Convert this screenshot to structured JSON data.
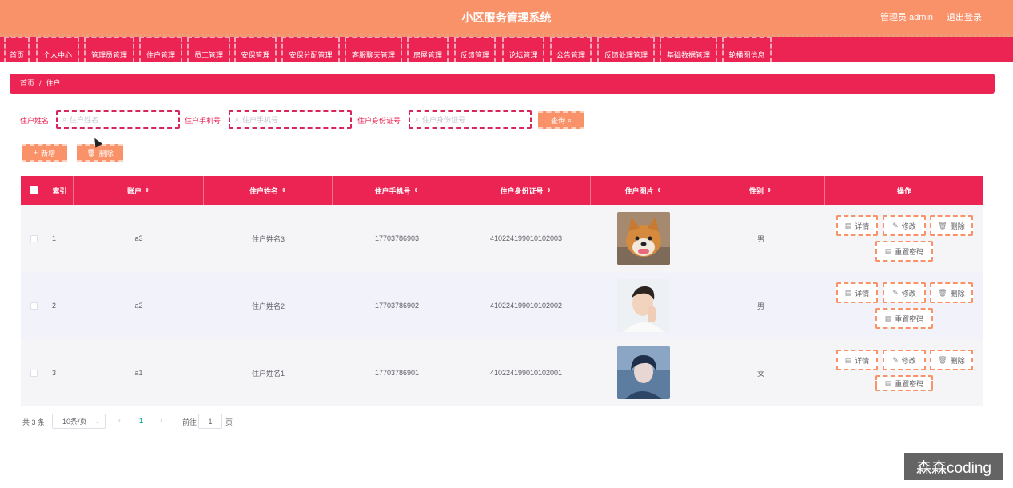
{
  "header": {
    "title": "小区服务管理系统",
    "admin": "管理员 admin",
    "logout": "退出登录"
  },
  "nav": [
    "首页",
    "个人中心",
    "管理员管理",
    "住户管理",
    "员工管理",
    "安保管理",
    "安保分配管理",
    "客服聊天管理",
    "房屋管理",
    "反馈管理",
    "论坛管理",
    "公告管理",
    "反馈处理管理",
    "基础数据管理",
    "轮播图信息"
  ],
  "breadcrumb": {
    "home": "首页",
    "sep": "/",
    "current": "住户"
  },
  "search": {
    "name_label": "住户姓名",
    "name_placeholder": "住户姓名",
    "phone_label": "住户手机号",
    "phone_placeholder": "住户手机号",
    "id_label": "住户身份证号",
    "id_placeholder": "住户身份证号",
    "query": "查询"
  },
  "actions": {
    "add": "新增",
    "delete": "删除"
  },
  "table": {
    "headers": [
      "索引",
      "账户",
      "住户姓名",
      "住户手机号",
      "住户身份证号",
      "住户图片",
      "性别",
      "操作"
    ],
    "rows": [
      {
        "index": "1",
        "account": "a3",
        "name": "住户姓名3",
        "phone": "17703786903",
        "idcard": "410224199010102003",
        "gender": "男",
        "photo": "shiba-dog"
      },
      {
        "index": "2",
        "account": "a2",
        "name": "住户姓名2",
        "phone": "17703786902",
        "idcard": "410224199010102002",
        "gender": "男",
        "photo": "young-man"
      },
      {
        "index": "3",
        "account": "a1",
        "name": "住户姓名1",
        "phone": "17703786901",
        "idcard": "410224199010102001",
        "gender": "女",
        "photo": "anime-boy"
      }
    ],
    "ops": {
      "detail": "详情",
      "edit": "修改",
      "delete": "删除",
      "reset": "重置密码"
    }
  },
  "pagination": {
    "total": "共 3 条",
    "size": "10条/页",
    "current": "1",
    "goto": "前往",
    "goto_value": "1",
    "page_unit": "页"
  },
  "watermark": "森森coding"
}
